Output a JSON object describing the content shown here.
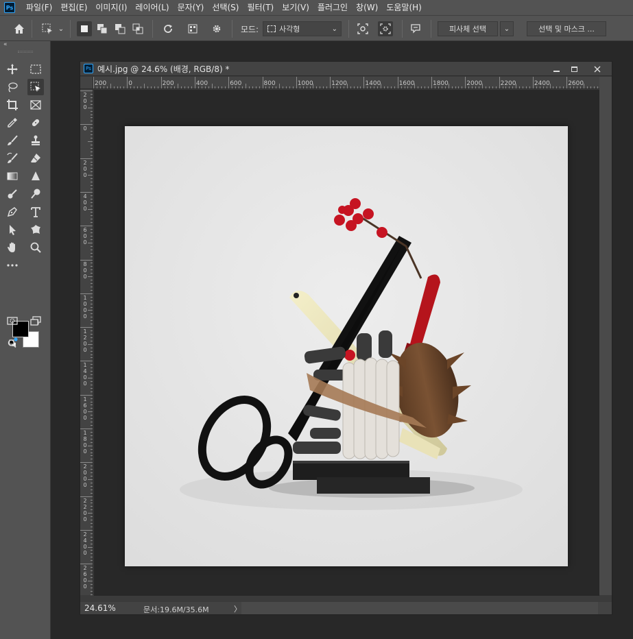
{
  "app": {
    "logo_text": "Ps",
    "menu": [
      "파일(F)",
      "편집(E)",
      "이미지(I)",
      "레이어(L)",
      "문자(Y)",
      "선택(S)",
      "필터(T)",
      "보기(V)",
      "플러그인",
      "창(W)",
      "도움말(H)"
    ]
  },
  "options": {
    "mode_label": "모드:",
    "mode_value": "사각형",
    "select_subject": "피사체 선택",
    "select_and_mask": "선택 및 마스크 ..."
  },
  "document": {
    "title": "예시.jpg @ 24.6% (배경, RGB/8) *",
    "icon_text": "Ps",
    "ruler_h_labels": [
      "200",
      "0",
      "200",
      "400",
      "600",
      "800",
      "1000",
      "1200",
      "1400",
      "1600",
      "1800",
      "2000",
      "2200",
      "2400",
      "2600"
    ],
    "ruler_v_labels": [
      "200",
      "0",
      "200",
      "400",
      "600",
      "800",
      "1000",
      "1200",
      "1400",
      "1600",
      "1800",
      "2000",
      "2200",
      "2400",
      "2600"
    ],
    "zoom": "24.61%",
    "doc_info": "문서:19.6M/35.6M",
    "status_arrow": "〉"
  },
  "colors": {
    "foreground": "#000000",
    "background": "#ffffff",
    "accent": "#31a8ff"
  }
}
